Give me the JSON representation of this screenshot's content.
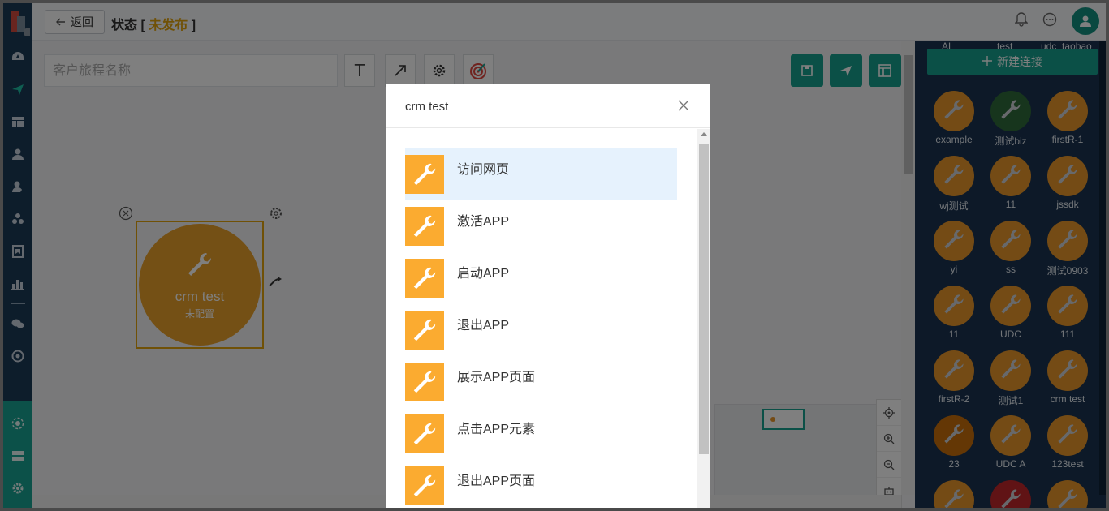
{
  "topbar": {
    "back_label": "返回",
    "status_prefix": "状态 [",
    "status_value": "未发布",
    "status_suffix": "]"
  },
  "canvas": {
    "name_placeholder": "客户旅程名称",
    "text_tool_glyph": "T",
    "node": {
      "title": "crm test",
      "subtitle": "未配置"
    }
  },
  "right_panel": {
    "new_connection_label": "新建连接",
    "cut_labels": [
      "AL",
      "test",
      "udc_taobao"
    ],
    "items": [
      {
        "label": "example",
        "color": "#e8962a"
      },
      {
        "label": "测试biz",
        "color": "#2f6b3a"
      },
      {
        "label": "firstR-1",
        "color": "#e8962a"
      },
      {
        "label": "wj测试",
        "color": "#e8962a"
      },
      {
        "label": "11",
        "color": "#e8962a"
      },
      {
        "label": "jssdk",
        "color": "#e8962a"
      },
      {
        "label": "yi",
        "color": "#e8962a"
      },
      {
        "label": "ss",
        "color": "#e8962a"
      },
      {
        "label": "测试0903",
        "color": "#e8962a"
      },
      {
        "label": "11",
        "color": "#e8962a"
      },
      {
        "label": "UDC",
        "color": "#e8962a"
      },
      {
        "label": "111",
        "color": "#e8962a"
      },
      {
        "label": "firstR-2",
        "color": "#e8962a"
      },
      {
        "label": "测试1",
        "color": "#e8962a"
      },
      {
        "label": "crm test",
        "color": "#e8962a"
      },
      {
        "label": "23",
        "color": "#c96f0a"
      },
      {
        "label": "UDC A",
        "color": "#e8962a"
      },
      {
        "label": "123test",
        "color": "#e8962a"
      },
      {
        "label": "",
        "color": "#e8962a"
      },
      {
        "label": "",
        "color": "#c0262b"
      },
      {
        "label": "",
        "color": "#e8962a"
      }
    ]
  },
  "modal": {
    "title": "crm test",
    "events": [
      {
        "label": "访问网页"
      },
      {
        "label": "激活APP"
      },
      {
        "label": "启动APP"
      },
      {
        "label": "退出APP"
      },
      {
        "label": "展示APP页面"
      },
      {
        "label": "点击APP元素"
      },
      {
        "label": "退出APP页面"
      }
    ]
  }
}
